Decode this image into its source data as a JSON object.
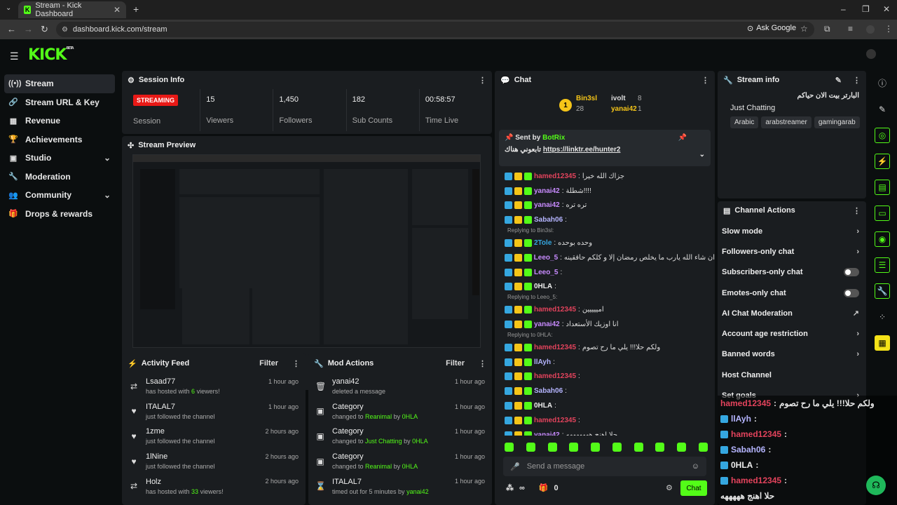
{
  "browser": {
    "tab_title": "Stream - Kick Dashboard",
    "tab_close": "✕",
    "new_tab": "+",
    "url": "dashboard.kick.com/stream",
    "ask_google": "Ask Google"
  },
  "app": {
    "logo": "KICK",
    "logo_beta": "BETA"
  },
  "sidebar": {
    "items": [
      {
        "label": "Stream",
        "icon": "stream-icon"
      },
      {
        "label": "Stream URL & Key",
        "icon": "link-icon"
      },
      {
        "label": "Revenue",
        "icon": "revenue-icon"
      },
      {
        "label": "Achievements",
        "icon": "trophy-icon"
      },
      {
        "label": "Studio",
        "icon": "studio-icon"
      },
      {
        "label": "Moderation",
        "icon": "wrench-icon"
      },
      {
        "label": "Community",
        "icon": "community-icon"
      },
      {
        "label": "Drops & rewards",
        "icon": "gift-icon"
      }
    ]
  },
  "session": {
    "title": "Session Info",
    "status": "STREAMING",
    "session_label": "Session",
    "stats": [
      {
        "value": "15",
        "label": "Viewers"
      },
      {
        "value": "1,450",
        "label": "Followers"
      },
      {
        "value": "182",
        "label": "Sub Counts"
      },
      {
        "value": "00:58:57",
        "label": "Time Live"
      }
    ]
  },
  "preview": {
    "title": "Stream Preview"
  },
  "activity": {
    "title": "Activity Feed",
    "filter": "Filter",
    "items": [
      {
        "name": "Lsaad77",
        "pre": "has hosted with ",
        "hl": "6",
        "post": " viewers!",
        "time": "1 hour ago",
        "icon": "host-icon"
      },
      {
        "name": "ITALAL7",
        "pre": "just followed the channel",
        "hl": "",
        "post": "",
        "time": "1 hour ago",
        "icon": "heart-icon"
      },
      {
        "name": "1zme",
        "pre": "just followed the channel",
        "hl": "",
        "post": "",
        "time": "2 hours ago",
        "icon": "heart-icon"
      },
      {
        "name": "1lNine",
        "pre": "just followed the channel",
        "hl": "",
        "post": "",
        "time": "2 hours ago",
        "icon": "heart-icon"
      },
      {
        "name": "Holz",
        "pre": "has hosted with ",
        "hl": "33",
        "post": " viewers!",
        "time": "2 hours ago",
        "icon": "host-icon"
      }
    ]
  },
  "mod": {
    "title": "Mod Actions",
    "filter": "Filter",
    "items": [
      {
        "name": "yanai42",
        "pre": "deleted a message",
        "hl": "",
        "mid": "",
        "by": "",
        "time": "1 hour ago",
        "icon": "trash-icon"
      },
      {
        "name": "Category",
        "pre": "changed to ",
        "hl": "Reanimal",
        "mid": " by ",
        "by": "0HLA",
        "time": "1 hour ago",
        "icon": "category-icon"
      },
      {
        "name": "Category",
        "pre": "changed to ",
        "hl": "Just Chatting",
        "mid": " by ",
        "by": "0HLA",
        "time": "1 hour ago",
        "icon": "category-icon"
      },
      {
        "name": "Category",
        "pre": "changed to ",
        "hl": "Reanimal",
        "mid": " by ",
        "by": "0HLA",
        "time": "1 hour ago",
        "icon": "category-icon"
      },
      {
        "name": "ITALAL7",
        "pre": "timed out for 5 minutes by ",
        "hl": "",
        "mid": "",
        "by": "yanai42",
        "time": "1 hour ago",
        "icon": "hourglass-icon"
      }
    ]
  },
  "chat": {
    "title": "Chat",
    "leaderboard": [
      {
        "rank": "1",
        "name": "Bin3sl",
        "count": "28"
      },
      {
        "rank": "",
        "name": "ivolt",
        "count": "8"
      },
      {
        "rank": "",
        "name": "yanai42",
        "count": "1"
      }
    ],
    "pinned": {
      "sent_by": "Sent by",
      "sender": "BotRix",
      "text": "تابعوني هناك",
      "link": "https://linktr.ee/hunter2"
    },
    "messages": [
      {
        "user": "hamed12345",
        "color": "#e3435c",
        "text": "جزاك الله خيرا",
        "reply": ""
      },
      {
        "user": "yanai42",
        "color": "#c88bff",
        "text": "شطلة!!!!",
        "reply": ""
      },
      {
        "user": "yanai42",
        "color": "#c88bff",
        "text": "ترە ترە",
        "reply": ""
      },
      {
        "user": "Sabah06",
        "color": "#b5b5ff",
        "text": "",
        "reply": ""
      },
      {
        "user": "2Tole",
        "color": "#35a7e0",
        "text": "وحده بوحده",
        "reply": "Replying to Bin3sl:"
      },
      {
        "user": "Leeo_5",
        "color": "#c88bff",
        "text": "ان شاء الله يارب ما يخلص رمضان إلا و كلكم حاققينه",
        "reply": ""
      },
      {
        "user": "Leeo_5",
        "color": "#c88bff",
        "text": "",
        "reply": ""
      },
      {
        "user": "0HLA",
        "color": "#eeeeee",
        "text": "",
        "reply": ""
      },
      {
        "user": "hamed12345",
        "color": "#e3435c",
        "text": "امييييين",
        "reply": "Replying to Leeo_5:"
      },
      {
        "user": "yanai42",
        "color": "#c88bff",
        "text": "انا اوزيك الأستعداد",
        "reply": ""
      },
      {
        "user": "hamed12345",
        "color": "#e3435c",
        "text": "ولكم حلا!!! يلي ما رح تصوم",
        "reply": "Replying to 0HLA:"
      },
      {
        "user": "llAyh",
        "color": "#b5b5ff",
        "text": "",
        "reply": ""
      },
      {
        "user": "hamed12345",
        "color": "#e3435c",
        "text": "",
        "reply": ""
      },
      {
        "user": "Sabah06",
        "color": "#b5b5ff",
        "text": "",
        "reply": ""
      },
      {
        "user": "0HLA",
        "color": "#eeeeee",
        "text": "",
        "reply": ""
      },
      {
        "user": "hamed12345",
        "color": "#e3435c",
        "text": "",
        "reply": ""
      },
      {
        "user": "yanai42",
        "color": "#c88bff",
        "text": "حلا اهنج هههههههه",
        "reply": ""
      }
    ],
    "input_placeholder": "Send a message",
    "infinite": "∞",
    "points": "0",
    "send": "Chat"
  },
  "stream_info": {
    "title": "Stream info",
    "stream_title": "البارتر بيت الان حياكم",
    "category": "Just Chatting",
    "tags": [
      "Arabic",
      "arabstreamer",
      "gamingarab"
    ]
  },
  "channel_actions": {
    "title": "Channel Actions",
    "items": [
      {
        "label": "Slow mode",
        "ctl": "arrow"
      },
      {
        "label": "Followers-only chat",
        "ctl": "arrow"
      },
      {
        "label": "Subscribers-only chat",
        "ctl": "toggle"
      },
      {
        "label": "Emotes-only chat",
        "ctl": "toggle"
      },
      {
        "label": "AI Chat Moderation",
        "ctl": "ext"
      },
      {
        "label": "Account age restriction",
        "ctl": "arrow"
      },
      {
        "label": "Banned words",
        "ctl": "arrow"
      },
      {
        "label": "Host Channel",
        "ctl": "none"
      },
      {
        "label": "Set goals",
        "ctl": "arrow"
      }
    ]
  },
  "overlay": {
    "rows": [
      {
        "user": "",
        "text": "ولكم حلا!!! يلي ما رح تصوم",
        "color": "#ffffff",
        "lead_user": "hamed12345"
      },
      {
        "user": "llAyh",
        "text": "",
        "color": "#b5b5ff"
      },
      {
        "user": "hamed12345",
        "text": "",
        "color": "#e3435c"
      },
      {
        "user": "Sabah06",
        "text": "",
        "color": "#b5b5ff"
      },
      {
        "user": "0HLA",
        "text": "",
        "color": "#eeeeee"
      },
      {
        "user": "hamed12345",
        "text": "",
        "color": "#e3435c"
      },
      {
        "user": "",
        "text": "حلا اهنج هههههه",
        "color": "#ffffff"
      }
    ]
  },
  "colors": {
    "accent": "#53fc18",
    "live": "#e91916",
    "panel": "#1a1d20"
  }
}
